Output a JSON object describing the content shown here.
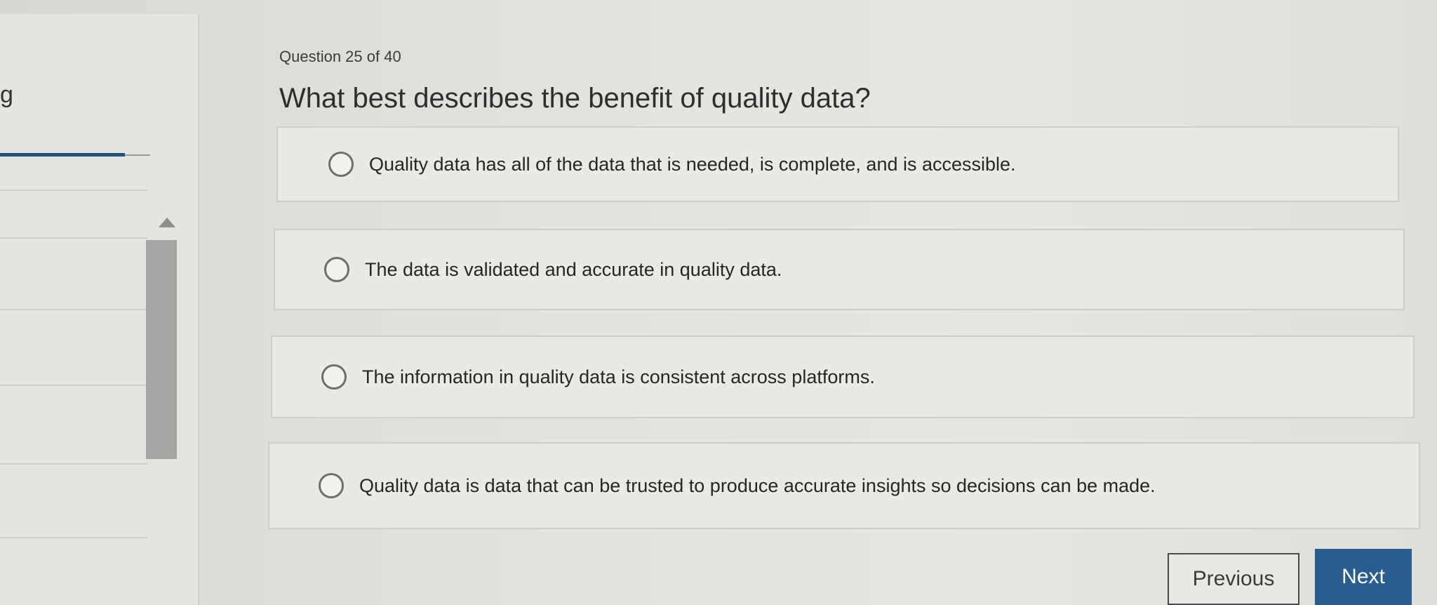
{
  "sidebar": {
    "edge_glyph": "g"
  },
  "question": {
    "counter": "Question 25 of 40",
    "text": "What best describes the benefit of quality data?"
  },
  "options": [
    {
      "label": "Quality data has all of the data that is needed, is complete, and is accessible.",
      "selected": false
    },
    {
      "label": "The data is validated and accurate in quality data.",
      "selected": false
    },
    {
      "label": "The information in quality data is consistent across platforms.",
      "selected": false
    },
    {
      "label": "Quality data is data that can be trusted to produce accurate insights so decisions can be made.",
      "selected": false
    }
  ],
  "navigation": {
    "previous_label": "Previous",
    "next_label": "Next"
  },
  "colors": {
    "accent": "#2a5d8f",
    "progress": "#1f4f7a"
  }
}
